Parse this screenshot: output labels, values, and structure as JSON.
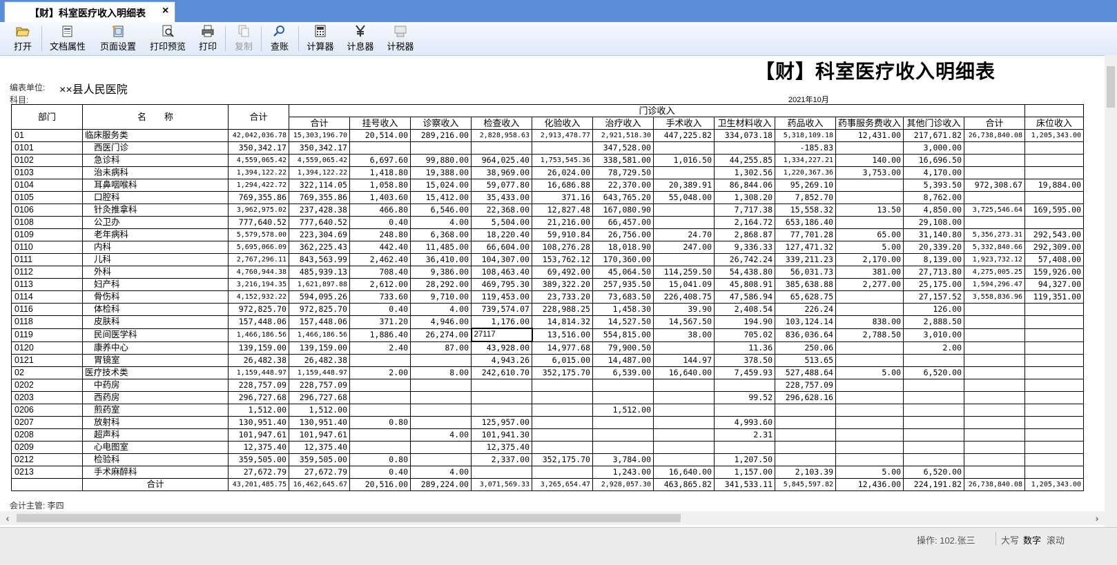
{
  "tab": {
    "title": "【财】科室医疗收入明细表",
    "close": "×"
  },
  "toolbar": [
    {
      "id": "open",
      "label": "打开"
    },
    {
      "id": "props",
      "label": "文档属性"
    },
    {
      "id": "pagesetup",
      "label": "页面设置"
    },
    {
      "id": "preview",
      "label": "打印预览"
    },
    {
      "id": "print",
      "label": "打印"
    },
    {
      "id": "copy",
      "label": "复制"
    },
    {
      "id": "audit",
      "label": "查账"
    },
    {
      "id": "calc",
      "label": "计算器"
    },
    {
      "id": "interest",
      "label": "计息器"
    },
    {
      "id": "tax",
      "label": "计税器"
    }
  ],
  "report": {
    "title": "【财】科室医疗收入明细表",
    "unit_label": "编表单位:",
    "unit_value": "××县人民医院",
    "subject_label": "科目:",
    "date": "2021年10月",
    "footer": "会计主管: 李四"
  },
  "headers": {
    "dept": "部门",
    "name": "名　　称",
    "total": "合计",
    "outpatient": "门诊收入",
    "cols": [
      "合计",
      "挂号收入",
      "诊察收入",
      "检查收入",
      "化验收入",
      "治疗收入",
      "手术收入",
      "卫生材料收入",
      "药品收入",
      "药事服务费收入",
      "其他门诊收入",
      "合计",
      "床位收入"
    ]
  },
  "rows": [
    {
      "code": "01",
      "name": "临床服务类",
      "top": true,
      "v": [
        "42,042,036.78",
        "15,303,196.70",
        "20,514.00",
        "289,216.00",
        "2,828,958.63",
        "2,913,478.77",
        "2,921,518.30",
        "447,225.82",
        "334,073.18",
        "5,318,109.18",
        "12,431.00",
        "217,671.82",
        "26,738,840.08",
        "1,205,343.00"
      ]
    },
    {
      "code": "0101",
      "name": "西医门诊",
      "v": [
        "350,342.17",
        "350,342.17",
        "",
        "",
        "",
        "",
        "347,528.00",
        "",
        "",
        "-185.83",
        "",
        "3,000.00",
        "",
        ""
      ]
    },
    {
      "code": "0102",
      "name": "急诊科",
      "v": [
        "4,559,065.42",
        "4,559,065.42",
        "6,697.60",
        "99,880.00",
        "964,025.40",
        "1,753,545.36",
        "338,581.00",
        "1,016.50",
        "44,255.85",
        "1,334,227.21",
        "140.00",
        "16,696.50",
        "",
        ""
      ]
    },
    {
      "code": "0103",
      "name": "治未病科",
      "v": [
        "1,394,122.22",
        "1,394,122.22",
        "1,418.80",
        "19,388.00",
        "38,969.00",
        "26,024.00",
        "78,729.50",
        "",
        "1,302.56",
        "1,220,367.36",
        "3,753.00",
        "4,170.00",
        "",
        ""
      ]
    },
    {
      "code": "0104",
      "name": "耳鼻咽喉科",
      "v": [
        "1,294,422.72",
        "322,114.05",
        "1,058.80",
        "15,024.00",
        "59,077.80",
        "16,686.88",
        "22,370.00",
        "20,389.91",
        "86,844.06",
        "95,269.10",
        "",
        "5,393.50",
        "972,308.67",
        "19,884.00"
      ]
    },
    {
      "code": "0105",
      "name": "口腔科",
      "v": [
        "769,355.86",
        "769,355.86",
        "1,403.60",
        "15,412.00",
        "35,433.00",
        "371.16",
        "643,765.20",
        "55,048.00",
        "1,308.20",
        "7,852.70",
        "",
        "8,762.00",
        "",
        ""
      ]
    },
    {
      "code": "0106",
      "name": "针灸推拿科",
      "v": [
        "3,962,975.02",
        "237,428.38",
        "466.80",
        "6,546.00",
        "22,368.00",
        "12,827.48",
        "167,080.90",
        "",
        "7,717.38",
        "15,558.32",
        "13.50",
        "4,850.00",
        "3,725,546.64",
        "169,595.00"
      ]
    },
    {
      "code": "0108",
      "name": "公卫办",
      "v": [
        "777,640.52",
        "777,640.52",
        "0.40",
        "4.00",
        "5,504.00",
        "21,216.00",
        "66,457.00",
        "",
        "2,164.72",
        "653,186.40",
        "",
        "29,108.00",
        "",
        ""
      ]
    },
    {
      "code": "0109",
      "name": "老年病科",
      "v": [
        "5,579,578.00",
        "223,304.69",
        "248.80",
        "6,368.00",
        "18,220.40",
        "59,910.84",
        "26,756.00",
        "24.70",
        "2,868.87",
        "77,701.28",
        "65.00",
        "31,140.80",
        "5,356,273.31",
        "292,543.00"
      ]
    },
    {
      "code": "0110",
      "name": "内科",
      "v": [
        "5,695,066.09",
        "362,225.43",
        "442.40",
        "11,485.00",
        "66,604.00",
        "108,276.28",
        "18,018.90",
        "247.00",
        "9,336.33",
        "127,471.32",
        "5.00",
        "20,339.20",
        "5,332,840.66",
        "292,309.00"
      ]
    },
    {
      "code": "0111",
      "name": "儿科",
      "v": [
        "2,767,296.11",
        "843,563.99",
        "2,462.40",
        "36,410.00",
        "104,307.00",
        "153,762.12",
        "170,360.00",
        "",
        "26,742.24",
        "339,211.23",
        "2,170.00",
        "8,139.00",
        "1,923,732.12",
        "57,408.00"
      ]
    },
    {
      "code": "0112",
      "name": "外科",
      "v": [
        "4,760,944.38",
        "485,939.13",
        "708.40",
        "9,386.00",
        "108,463.40",
        "69,492.00",
        "45,064.50",
        "114,259.50",
        "54,438.80",
        "56,031.73",
        "381.00",
        "27,713.80",
        "4,275,005.25",
        "159,926.00"
      ]
    },
    {
      "code": "0113",
      "name": "妇产科",
      "v": [
        "3,216,194.35",
        "1,621,897.88",
        "2,612.00",
        "28,292.00",
        "469,795.30",
        "389,322.20",
        "257,935.50",
        "15,041.09",
        "45,808.91",
        "385,638.88",
        "2,277.00",
        "25,175.00",
        "1,594,296.47",
        "94,327.00"
      ]
    },
    {
      "code": "0114",
      "name": "骨伤科",
      "v": [
        "4,152,932.22",
        "594,095.26",
        "733.60",
        "9,710.00",
        "119,453.00",
        "23,733.20",
        "73,683.50",
        "226,408.75",
        "47,586.94",
        "65,628.75",
        "",
        "27,157.52",
        "3,558,836.96",
        "119,351.00"
      ]
    },
    {
      "code": "0116",
      "name": "体检科",
      "v": [
        "972,825.70",
        "972,825.70",
        "0.40",
        "4.00",
        "739,574.07",
        "228,988.25",
        "1,458.30",
        "39.90",
        "2,408.54",
        "226.24",
        "",
        "126.00",
        "",
        ""
      ]
    },
    {
      "code": "0118",
      "name": "皮肤科",
      "v": [
        "157,448.06",
        "157,448.06",
        "371.20",
        "4,946.00",
        "1,176.00",
        "14,814.32",
        "14,527.50",
        "14,567.50",
        "194.90",
        "103,124.14",
        "838.00",
        "2,888.50",
        "",
        ""
      ]
    },
    {
      "code": "0119",
      "name": "民间医学科",
      "editing": true,
      "v": [
        "1,466,186.56",
        "1,466,186.56",
        "1,886.40",
        "26,274.00",
        "27117",
        "13,516.00",
        "554,815.00",
        "38.00",
        "705.02",
        "836,036.64",
        "2,788.50",
        "3,010.00",
        "",
        ""
      ]
    },
    {
      "code": "0120",
      "name": "康养中心",
      "v": [
        "139,159.00",
        "139,159.00",
        "2.40",
        "87.00",
        "43,928.00",
        "14,977.68",
        "79,900.50",
        "",
        "11.36",
        "250.06",
        "",
        "2.00",
        "",
        ""
      ]
    },
    {
      "code": "0121",
      "name": "胃镜室",
      "v": [
        "26,482.38",
        "26,482.38",
        "",
        "",
        "4,943.26",
        "6,015.00",
        "14,487.00",
        "144.97",
        "378.50",
        "513.65",
        "",
        "",
        "",
        ""
      ]
    },
    {
      "code": "02",
      "name": "医疗技术类",
      "top": true,
      "v": [
        "1,159,448.97",
        "1,159,448.97",
        "2.00",
        "8.00",
        "242,610.70",
        "352,175.70",
        "6,539.00",
        "16,640.00",
        "7,459.93",
        "527,488.64",
        "5.00",
        "6,520.00",
        "",
        ""
      ]
    },
    {
      "code": "0202",
      "name": "中药房",
      "v": [
        "228,757.09",
        "228,757.09",
        "",
        "",
        "",
        "",
        "",
        "",
        "",
        "228,757.09",
        "",
        "",
        "",
        ""
      ]
    },
    {
      "code": "0203",
      "name": "西药房",
      "v": [
        "296,727.68",
        "296,727.68",
        "",
        "",
        "",
        "",
        "",
        "",
        "99.52",
        "296,628.16",
        "",
        "",
        "",
        ""
      ]
    },
    {
      "code": "0206",
      "name": "煎药室",
      "v": [
        "1,512.00",
        "1,512.00",
        "",
        "",
        "",
        "",
        "1,512.00",
        "",
        "",
        "",
        "",
        "",
        "",
        ""
      ]
    },
    {
      "code": "0207",
      "name": "放射科",
      "v": [
        "130,951.40",
        "130,951.40",
        "0.80",
        "",
        "125,957.00",
        "",
        "",
        "",
        "4,993.60",
        "",
        "",
        "",
        "",
        ""
      ]
    },
    {
      "code": "0208",
      "name": "超声科",
      "v": [
        "101,947.61",
        "101,947.61",
        "",
        "4.00",
        "101,941.30",
        "",
        "",
        "",
        "2.31",
        "",
        "",
        "",
        "",
        ""
      ]
    },
    {
      "code": "0209",
      "name": "心电图室",
      "v": [
        "12,375.40",
        "12,375.40",
        "",
        "",
        "12,375.40",
        "",
        "",
        "",
        "",
        "",
        "",
        "",
        "",
        ""
      ]
    },
    {
      "code": "0212",
      "name": "检验科",
      "v": [
        "359,505.00",
        "359,505.00",
        "0.80",
        "",
        "2,337.00",
        "352,175.70",
        "3,784.00",
        "",
        "1,207.50",
        "",
        "",
        "",
        "",
        ""
      ]
    },
    {
      "code": "0213",
      "name": "手术麻醉科",
      "v": [
        "27,672.79",
        "27,672.79",
        "0.40",
        "4.00",
        "",
        "",
        "1,243.00",
        "16,640.00",
        "1,157.00",
        "2,103.39",
        "5.00",
        "6,520.00",
        "",
        ""
      ]
    }
  ],
  "total_row": {
    "label": "合计",
    "v": [
      "43,201,485.75",
      "16,462,645.67",
      "20,516.00",
      "289,224.00",
      "3,071,569.33",
      "3,265,654.47",
      "2,928,057.30",
      "463,865.82",
      "341,533.11",
      "5,845,597.82",
      "12,436.00",
      "224,191.82",
      "26,738,840.08",
      "1,205,343.00"
    ]
  },
  "status": {
    "operator": "操作: 102.张三",
    "caps": "大写",
    "num": "数字",
    "scroll": "滚动"
  }
}
